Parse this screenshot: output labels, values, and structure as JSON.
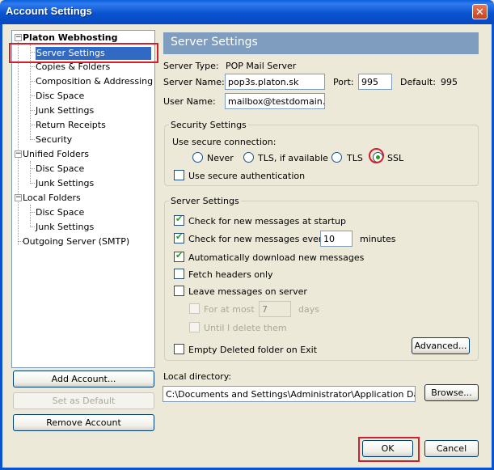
{
  "window": {
    "title": "Account Settings",
    "close_glyph": "✕"
  },
  "tree": {
    "account1": {
      "label": "Platon Webhosting",
      "toggle": "−"
    },
    "account1_items": [
      "Server Settings",
      "Copies & Folders",
      "Composition & Addressing",
      "Disc Space",
      "Junk Settings",
      "Return Receipts",
      "Security"
    ],
    "account2": {
      "label": "Unified Folders",
      "toggle": "−"
    },
    "account2_items": [
      "Disc Space",
      "Junk Settings"
    ],
    "account3": {
      "label": "Local Folders",
      "toggle": "−"
    },
    "account3_items": [
      "Disc Space",
      "Junk Settings"
    ],
    "outgoing": "Outgoing Server (SMTP)",
    "selected": "Server Settings"
  },
  "left_buttons": {
    "add": "Add Account...",
    "default": "Set as Default",
    "remove": "Remove Account"
  },
  "panel": {
    "header": "Server Settings",
    "server_type_label": "Server Type:",
    "server_type_value": "POP Mail Server",
    "server_name_label": "Server Name:",
    "server_name_value": "pop3s.platon.sk",
    "port_label": "Port:",
    "port_value": "995",
    "default_label": "Default:",
    "default_value": "995",
    "user_name_label": "User Name:",
    "user_name_value": "mailbox@testdomain.sk"
  },
  "security": {
    "group_title": "Security Settings",
    "use_secure_label": "Use secure connection:",
    "options": [
      "Never",
      "TLS, if available",
      "TLS",
      "SSL"
    ],
    "selected": "SSL",
    "secure_auth_label": "Use secure authentication",
    "secure_auth_checked": false
  },
  "server_settings": {
    "group_title": "Server Settings",
    "check_startup": {
      "label": "Check for new messages at startup",
      "checked": true
    },
    "check_every": {
      "label": "Check for new messages every",
      "checked": true,
      "value": "10",
      "unit": "minutes"
    },
    "auto_download": {
      "label": "Automatically download new messages",
      "checked": true
    },
    "fetch_headers": {
      "label": "Fetch headers only",
      "checked": false
    },
    "leave_on_server": {
      "label": "Leave messages on server",
      "checked": false
    },
    "for_at_most": {
      "label": "For at most",
      "value": "7",
      "unit": "days",
      "checked": false
    },
    "until_delete": {
      "label": "Until I delete them",
      "checked": false
    },
    "empty_deleted": {
      "label": "Empty Deleted folder on Exit",
      "checked": false
    },
    "advanced_button": "Advanced..."
  },
  "local_directory": {
    "label": "Local directory:",
    "value": "C:\\Documents and Settings\\Administrator\\Application Data\\Thur",
    "browse_button": "Browse..."
  },
  "footer": {
    "ok": "OK",
    "cancel": "Cancel"
  },
  "colors": {
    "titlebar": "#0a53d0",
    "header_bg": "#7f9dbf",
    "selection": "#316ac5",
    "highlight_box": "#d0202b",
    "dialog_bg": "#ece9d8"
  }
}
